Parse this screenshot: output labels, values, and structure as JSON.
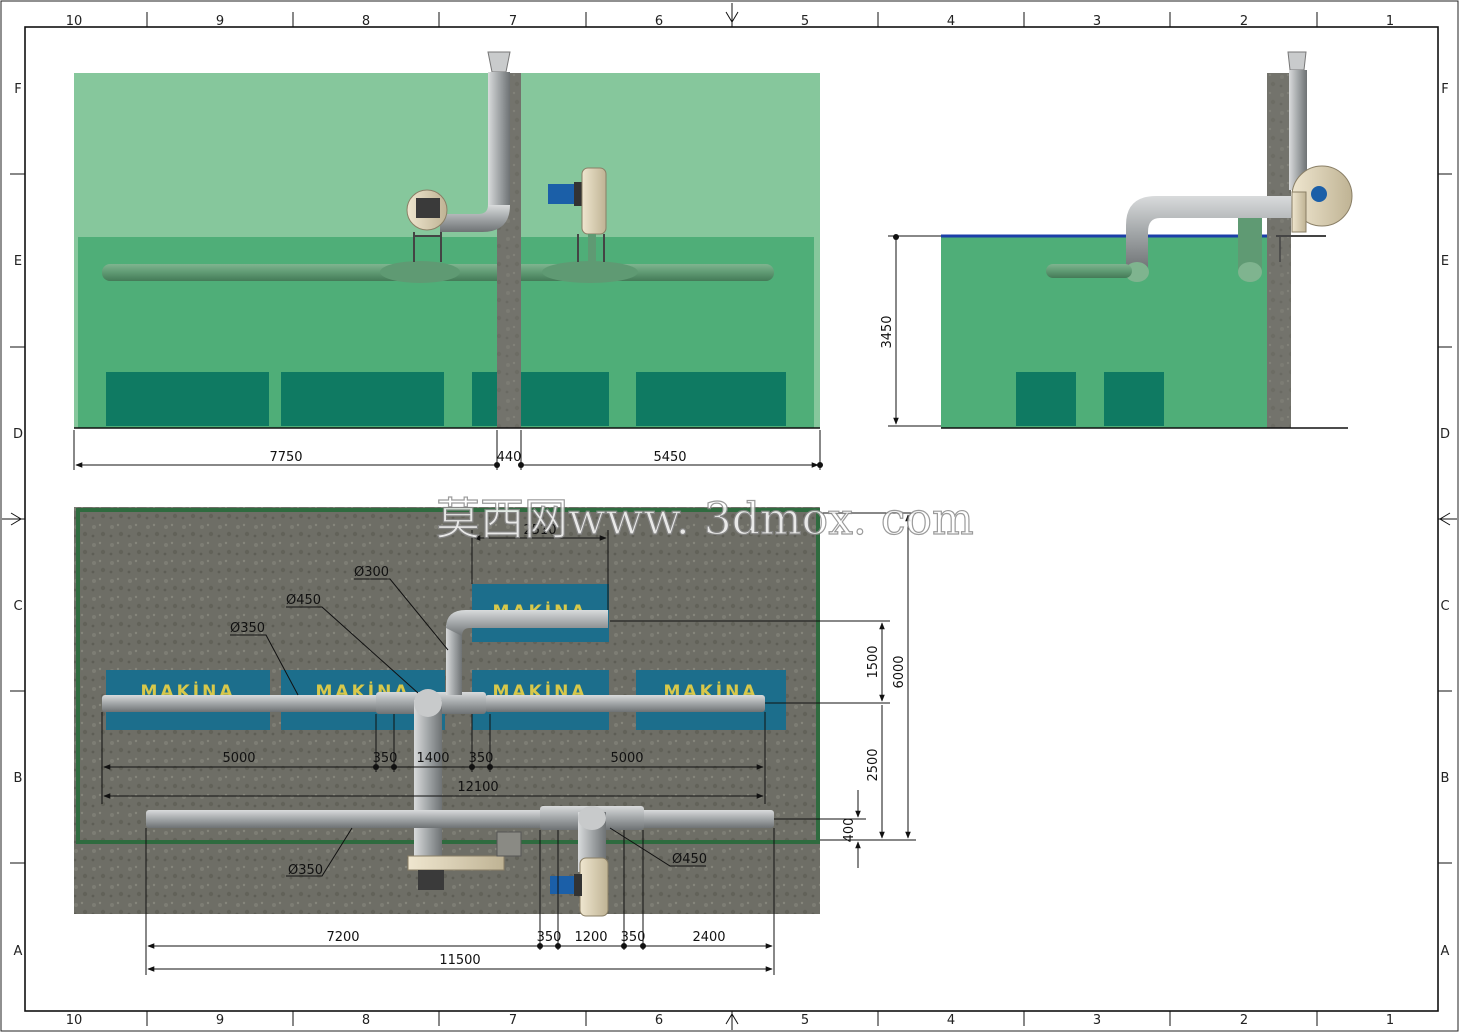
{
  "border": {
    "top_columns": [
      "10",
      "9",
      "8",
      "7",
      "6",
      "5",
      "4",
      "3",
      "2",
      "1"
    ],
    "bottom_columns": [
      "10",
      "9",
      "8",
      "7",
      "6",
      "5",
      "4",
      "3",
      "2",
      "1"
    ],
    "left_rows": [
      "F",
      "E",
      "D",
      "C",
      "B",
      "A"
    ],
    "right_rows": [
      "F",
      "E",
      "D",
      "C",
      "B",
      "A"
    ]
  },
  "watermark": "莫西网www. 3dmox. com",
  "colors": {
    "room": "#4fae78",
    "room_light": "#86c79c",
    "machine": "#0f7a62",
    "floor": "#707068",
    "pipe": "#a8acae",
    "machine_plan": "#1c6e8c",
    "label_yellow": "#d8c84a"
  },
  "front_view": {
    "dims": {
      "left": "7750",
      "mid": "440",
      "right": "5450"
    }
  },
  "side_view": {
    "dims": {
      "height": "3450"
    }
  },
  "plan_view": {
    "machine_label": "MAKİNA",
    "diameters": {
      "d300": "Ø300",
      "d450_top": "Ø450",
      "d350_top": "Ø350",
      "d350_bottom": "Ø350",
      "d450_bottom": "Ø450"
    },
    "dims": {
      "top_width": "2510",
      "row1_left": "5000",
      "row1_a": "350",
      "row1_mid": "1400",
      "row1_b": "350",
      "row1_right": "5000",
      "row1_total": "12100",
      "v_1500": "1500",
      "v_6000": "6000",
      "v_2500": "2500",
      "v_400": "400",
      "row2_left": "7200",
      "row2_a": "350",
      "row2_mid": "1200",
      "row2_b": "350",
      "row2_right": "2400",
      "row2_total": "11500"
    }
  }
}
